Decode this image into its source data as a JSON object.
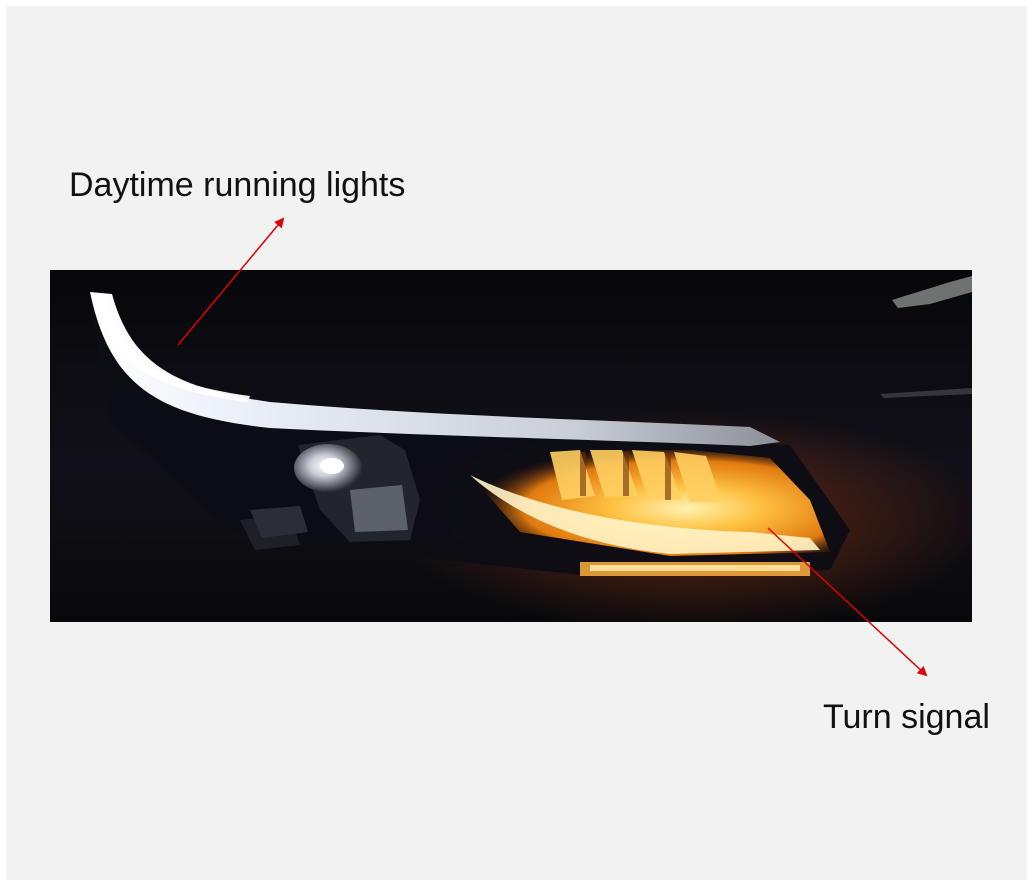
{
  "annotations": {
    "daytime_running_lights": "Daytime running lights",
    "turn_signal": "Turn signal"
  },
  "photo": {
    "subject": "car-headlight-night",
    "colors": {
      "drl_light": "#eef4ff",
      "turn_signal_light": "#ffb020",
      "housing": "#0b0b10"
    }
  },
  "style": {
    "arrow_color": "#e00000",
    "panel_background": "#f2f2f2"
  }
}
